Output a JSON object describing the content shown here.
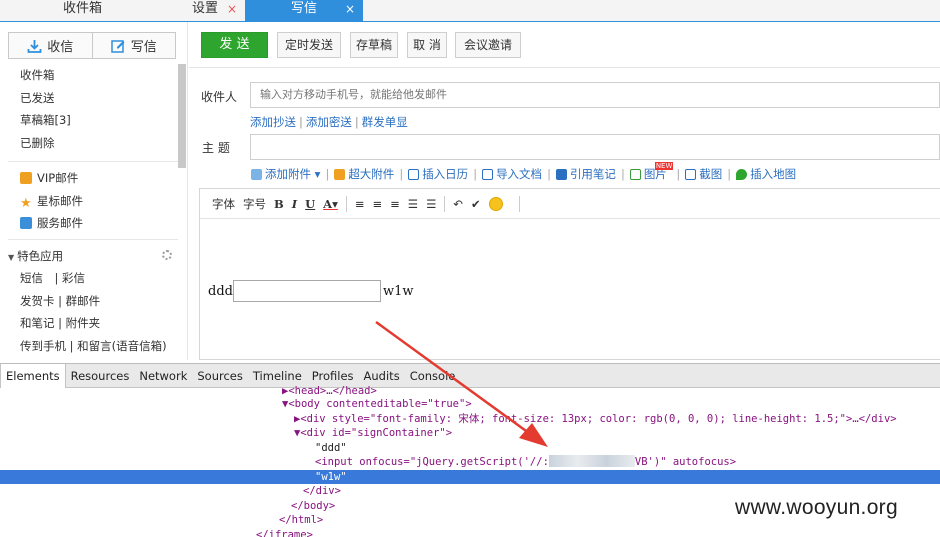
{
  "tabs": [
    {
      "label": "收件箱",
      "closable": false
    },
    {
      "label": "设置",
      "closable": true
    },
    {
      "label": "写信",
      "closable": true,
      "active": true
    }
  ],
  "close_glyph": "×",
  "sidebar": {
    "receive_label": "收信",
    "compose_label": "写信",
    "folders": [
      "收件箱",
      "已发送",
      "草稿箱[3]",
      "已删除"
    ],
    "special": [
      {
        "label": "VIP邮件",
        "icon": "vip-icon"
      },
      {
        "label": "星标邮件",
        "icon": "star-icon"
      },
      {
        "label": "服务邮件",
        "icon": "service-icon"
      }
    ],
    "apps_title": "特色应用",
    "apps": [
      "短信　| 彩信",
      "发贺卡 | 群邮件",
      "和笔记 | 附件夹",
      "传到手机 | 和留言(语音信箱)"
    ]
  },
  "compose": {
    "send_label": "发 送",
    "schedule_label": "定时发送",
    "draft_label": "存草稿",
    "cancel_label": "取 消",
    "meeting_label": "会议邀请",
    "to_label": "收件人",
    "to_placeholder": "输入对方移动手机号，就能给他发邮件",
    "add_cc": "添加抄送",
    "add_bcc": "添加密送",
    "group_send": "群发单显",
    "subject_label": "主 题",
    "attach_items": [
      "添加附件 ▾",
      "超大附件",
      "插入日历",
      "导入文档",
      "引用笔记",
      "图片",
      "截图",
      "插入地图"
    ],
    "new_badge": "NEW",
    "fmt_font": "字体",
    "fmt_size": "字号",
    "fmt_buttons": [
      "B",
      "I",
      "U",
      "A▾"
    ],
    "editor_text_before": "ddd",
    "editor_text_after": "w1w"
  },
  "devtools": {
    "tabs": [
      "Elements",
      "Resources",
      "Network",
      "Sources",
      "Timeline",
      "Profiles",
      "Audits",
      "Console"
    ],
    "active_tab": "Elements",
    "lines": [
      {
        "text": "▶<head>…</head>"
      },
      {
        "text": "▼<body contenteditable=\"true\">"
      },
      {
        "text": "▶<div style=\"font-family: 宋体; font-size: 13px; color: rgb(0, 0, 0); line-height: 1.5;\">…</div>"
      },
      {
        "text": "▼<div id=\"signContainer\">"
      },
      {
        "text": "\"ddd\""
      },
      {
        "text_before": "<input onfocus=\"jQuery.getScript('//:",
        "text_after": "VB')\" autofocus>"
      },
      {
        "text": "\"w1w\"",
        "selected": true
      },
      {
        "text": "</div>"
      },
      {
        "text": "</body>"
      },
      {
        "text": "</html>"
      },
      {
        "text": "</iframe>"
      }
    ]
  },
  "watermark": "www.wooyun.org",
  "colors": {
    "accent": "#2f8fdc",
    "send": "#2ea52e",
    "link": "#2b6fc1",
    "arrow": "#e33b2f",
    "selection": "#3879d9"
  }
}
